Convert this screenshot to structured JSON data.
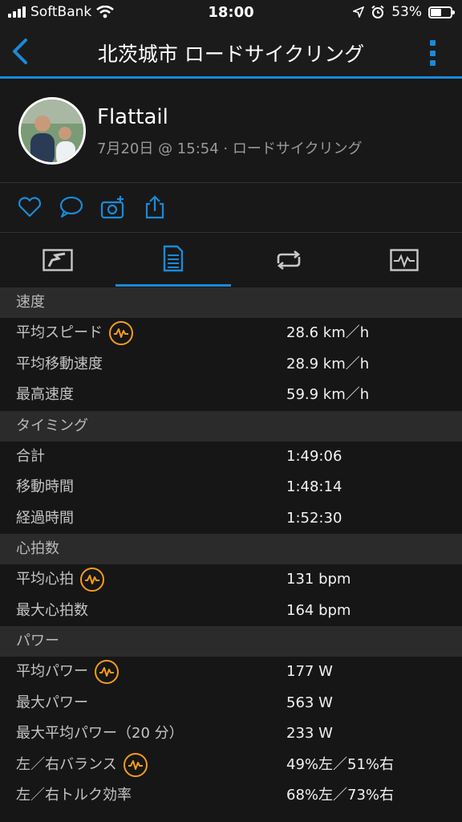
{
  "status_bar": {
    "carrier": "SoftBank",
    "time": "18:00",
    "battery": "53%",
    "battery_level": 0.53,
    "icons": [
      "signal-bars-icon",
      "wifi-icon",
      "location-arrow-icon",
      "alarm-icon",
      "battery-icon"
    ]
  },
  "nav": {
    "title": "北茨城市 ロードサイクリング",
    "accent": "#1a8ad8"
  },
  "profile": {
    "name": "Flattail",
    "meta": "7月20日 @ 15:54 · ロードサイクリング"
  },
  "actions": [
    "heart-icon",
    "comment-icon",
    "add-photo-icon",
    "share-icon"
  ],
  "tabs": [
    "map-tab-icon",
    "stats-tab-icon",
    "laps-tab-icon",
    "charts-tab-icon"
  ],
  "sections": [
    {
      "title": "速度",
      "rows": [
        {
          "label": "平均スピード",
          "value": "28.6 km／h",
          "badge": true
        },
        {
          "label": "平均移動速度",
          "value": "28.9 km／h",
          "badge": false
        },
        {
          "label": "最高速度",
          "value": "59.9 km／h",
          "badge": false
        }
      ]
    },
    {
      "title": "タイミング",
      "rows": [
        {
          "label": "合計",
          "value": "1:49:06",
          "badge": false
        },
        {
          "label": "移動時間",
          "value": "1:48:14",
          "badge": false
        },
        {
          "label": "経過時間",
          "value": "1:52:30",
          "badge": false
        }
      ]
    },
    {
      "title": "心拍数",
      "rows": [
        {
          "label": "平均心拍",
          "value": "131 bpm",
          "badge": true
        },
        {
          "label": "最大心拍数",
          "value": "164 bpm",
          "badge": false
        }
      ]
    },
    {
      "title": "パワー",
      "rows": [
        {
          "label": "平均パワー",
          "value": "177 W",
          "badge": true
        },
        {
          "label": "最大パワー",
          "value": "563 W",
          "badge": false
        },
        {
          "label": "最大平均パワー（20 分）",
          "value": "233 W",
          "badge": false
        },
        {
          "label": "左／右バランス",
          "value": "49%左／51%右",
          "badge": true
        },
        {
          "label": "左／右トルク効率",
          "value": "68%左／73%右",
          "badge": false
        }
      ]
    }
  ],
  "colors": {
    "badge": "#f39c1b",
    "section_bg": "#2b2b2b"
  }
}
